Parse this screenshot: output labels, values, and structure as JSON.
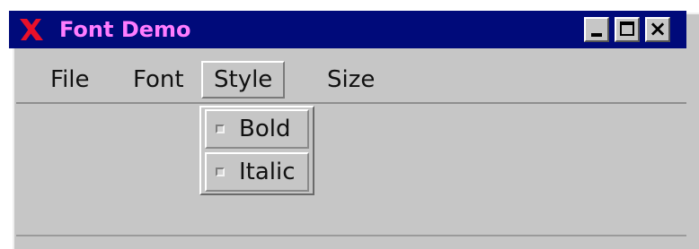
{
  "window": {
    "title": "Font Demo",
    "icon": "x-logo-icon",
    "controls": [
      "minimize-icon",
      "maximize-icon",
      "close-icon"
    ]
  },
  "menubar": {
    "items": [
      {
        "label": "File"
      },
      {
        "label": "Font"
      },
      {
        "label": "Style"
      },
      {
        "label": "Size"
      }
    ]
  },
  "style_menu": {
    "items": [
      {
        "label": "Bold",
        "checked": false
      },
      {
        "label": "Italic",
        "checked": false
      }
    ]
  },
  "colors": {
    "titlebar": "#000a7a",
    "title_text": "#ff7cff",
    "icon_red": "#e8102a",
    "face": "#c6c6c6"
  }
}
